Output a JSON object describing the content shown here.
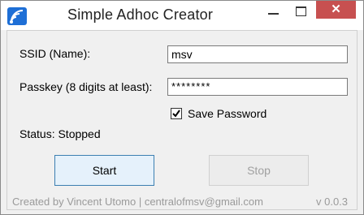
{
  "window": {
    "title": "Simple Adhoc Creator",
    "icon": "wifi-app-icon",
    "controls": [
      "minimize-icon",
      "maximize-icon",
      "close-icon"
    ]
  },
  "form": {
    "ssid_label": "SSID (Name):",
    "ssid_value": "msv",
    "passkey_label": "Passkey (8 digits at least):",
    "passkey_value": "********",
    "save_password_label": "Save Password",
    "save_password_checked": true,
    "status_text": "Status: Stopped"
  },
  "buttons": {
    "start_label": "Start",
    "stop_label": "Stop"
  },
  "footer": {
    "credits": "Created by Vincent Utomo | centralofmsv@gmail.com",
    "version": "v 0.0.3"
  },
  "colors": {
    "close_button": "#c75050",
    "title_icon": "#1e6fd6",
    "footer_text": "#9a9a9a"
  }
}
